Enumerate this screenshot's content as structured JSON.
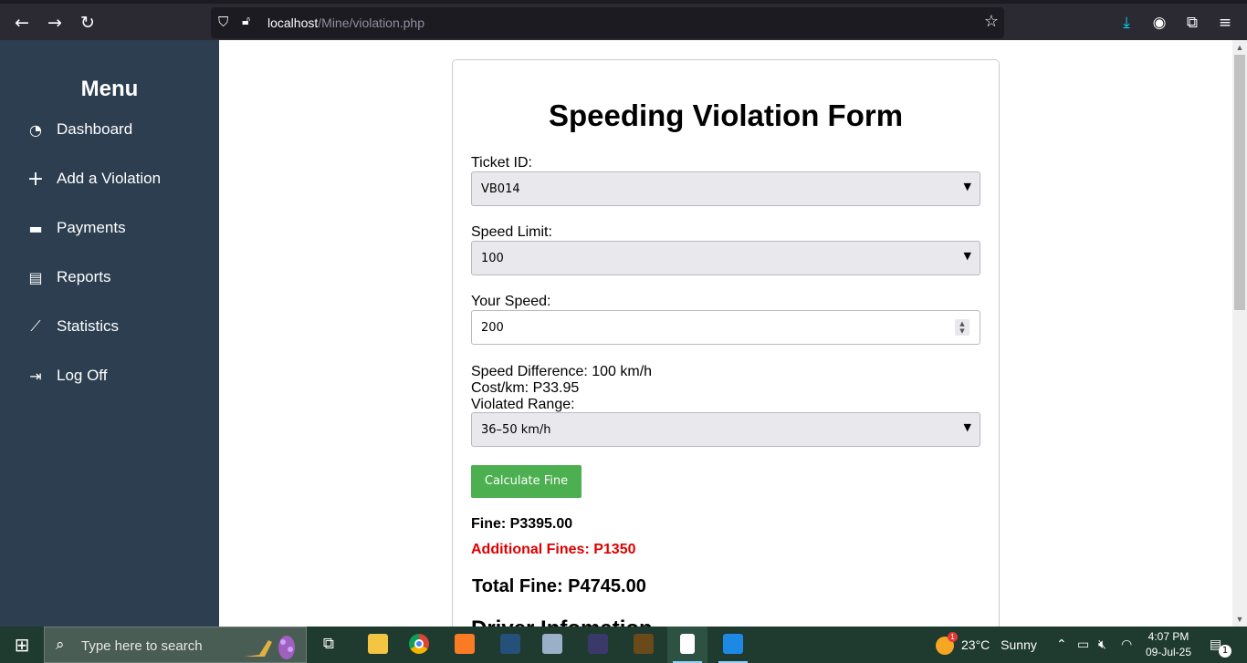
{
  "browser": {
    "url_host": "localhost",
    "url_path": "/Mine/violation.php"
  },
  "sidebar": {
    "title": "Menu",
    "items": [
      {
        "label": "Dashboard",
        "icon": "dashboard-icon",
        "glyph": "◔"
      },
      {
        "label": "Add a Violation",
        "icon": "plus-icon",
        "glyph": "+"
      },
      {
        "label": "Payments",
        "icon": "credit-card-icon",
        "glyph": "▬"
      },
      {
        "label": "Reports",
        "icon": "file-icon",
        "glyph": "▤"
      },
      {
        "label": "Statistics",
        "icon": "line-chart-icon",
        "glyph": "⟋"
      },
      {
        "label": "Log Off",
        "icon": "sign-out-icon",
        "glyph": "⇥"
      }
    ]
  },
  "form": {
    "title": "Speeding Violation Form",
    "ticket_label": "Ticket ID:",
    "ticket_value": "VB014",
    "speed_limit_label": "Speed Limit:",
    "speed_limit_value": "100",
    "your_speed_label": "Your Speed:",
    "your_speed_value": "200",
    "speed_difference": "Speed Difference: 100 km/h",
    "cost_per_km": "Cost/km: P33.95",
    "violated_range_label": "Violated Range:",
    "violated_range_value": "36–50 km/h",
    "calculate_button": "Calculate Fine",
    "fine": "Fine: P3395.00",
    "additional_fines": "Additional Fines: P1350",
    "total_fine": "Total Fine: P4745.00",
    "driver_section": "Driver Infomation"
  },
  "taskbar": {
    "search_placeholder": "Type here to search",
    "weather_temp": "23°C",
    "weather_cond": "Sunny",
    "time": "4:07 PM",
    "date": "09-Jul-25",
    "notification_count": "1",
    "weather_badge": "1"
  },
  "colors": {
    "sidebar_bg": "#2c3e50",
    "button_green": "#4caf50",
    "additional_red": "#e00000"
  }
}
